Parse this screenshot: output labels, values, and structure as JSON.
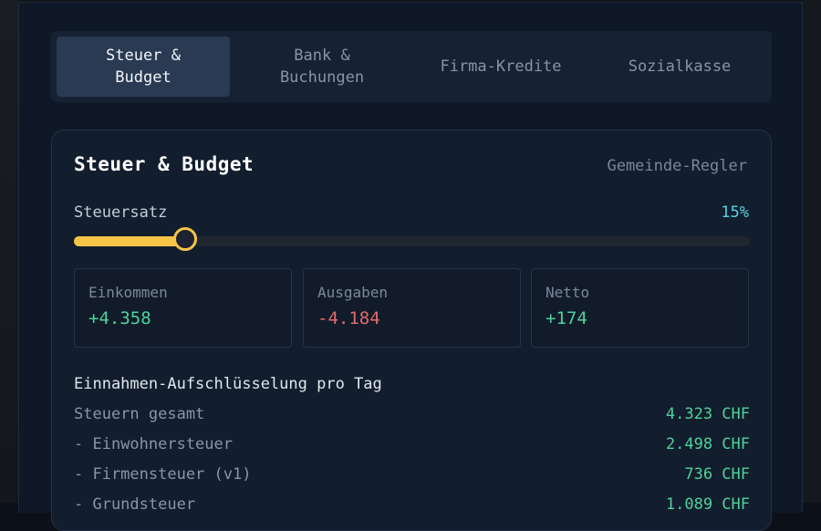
{
  "tabs": [
    {
      "label": "Steuer &\nBudget",
      "active": true
    },
    {
      "label": "Bank &\nBuchungen",
      "active": false
    },
    {
      "label": "Firma-Kredite",
      "active": false
    },
    {
      "label": "Sozialkasse",
      "active": false
    }
  ],
  "card": {
    "title": "Steuer & Budget",
    "subtitle": "Gemeinde-Regler"
  },
  "tax_slider": {
    "label": "Steuersatz",
    "value_text": "15%",
    "level_fraction": 0.165
  },
  "stats": {
    "income": {
      "label": "Einkommen",
      "value": "+4.358"
    },
    "expenses": {
      "label": "Ausgaben",
      "value": "-4.184"
    },
    "net": {
      "label": "Netto",
      "value": "+174"
    }
  },
  "breakdown": {
    "title": "Einnahmen-Aufschlüsselung pro Tag",
    "rows": [
      {
        "label": "Steuern gesamt",
        "value": "4.323 CHF"
      },
      {
        "label": "- Einwohnersteuer",
        "value": "2.498 CHF"
      },
      {
        "label": "- Firmensteuer (v1)",
        "value": "736 CHF"
      },
      {
        "label": "- Grundsteuer",
        "value": "1.089 CHF"
      }
    ]
  },
  "colors": {
    "accent_yellow": "#f6c547",
    "positive": "#4fd29a",
    "negative": "#e06c6c",
    "percent": "#56d4e6"
  }
}
